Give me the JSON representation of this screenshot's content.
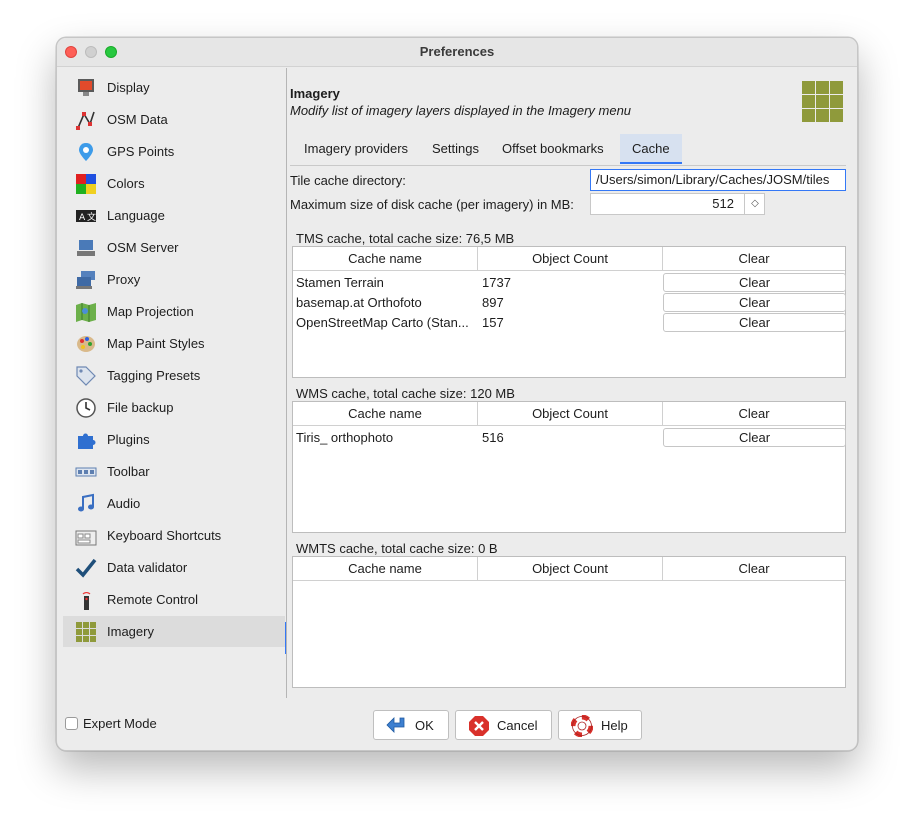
{
  "window": {
    "title": "Preferences"
  },
  "sidebar": {
    "items": [
      {
        "label": "Display",
        "icon": "display-icon"
      },
      {
        "label": "OSM Data",
        "icon": "osm-data-icon"
      },
      {
        "label": "GPS Points",
        "icon": "gps-points-icon"
      },
      {
        "label": "Colors",
        "icon": "colors-icon"
      },
      {
        "label": "Language",
        "icon": "language-icon"
      },
      {
        "label": "OSM Server",
        "icon": "osm-server-icon"
      },
      {
        "label": "Proxy",
        "icon": "proxy-icon"
      },
      {
        "label": "Map Projection",
        "icon": "map-projection-icon"
      },
      {
        "label": "Map Paint Styles",
        "icon": "map-paint-styles-icon"
      },
      {
        "label": "Tagging Presets",
        "icon": "tagging-presets-icon"
      },
      {
        "label": "File backup",
        "icon": "file-backup-icon"
      },
      {
        "label": "Plugins",
        "icon": "plugins-icon"
      },
      {
        "label": "Toolbar",
        "icon": "toolbar-icon"
      },
      {
        "label": "Audio",
        "icon": "audio-icon"
      },
      {
        "label": "Keyboard Shortcuts",
        "icon": "keyboard-shortcuts-icon"
      },
      {
        "label": "Data validator",
        "icon": "data-validator-icon"
      },
      {
        "label": "Remote Control",
        "icon": "remote-control-icon"
      },
      {
        "label": "Imagery",
        "icon": "imagery-icon",
        "selected": true
      }
    ]
  },
  "header": {
    "title": "Imagery",
    "subtitle": "Modify list of imagery layers displayed in the Imagery menu"
  },
  "tabs": [
    "Imagery providers",
    "Settings",
    "Offset bookmarks",
    "Cache"
  ],
  "active_tab": "Cache",
  "cache": {
    "dir_label": "Tile cache directory:",
    "dir_value": "/Users/simon/Library/Caches/JOSM/tiles",
    "max_label": "Maximum size of disk cache (per imagery) in MB:",
    "max_value": "512",
    "columns": [
      "Cache name",
      "Object Count",
      "Clear"
    ],
    "tms_label": "TMS cache, total cache size: 76,5 MB",
    "tms_rows": [
      {
        "name": "Stamen Terrain",
        "count": "1737",
        "clear": "Clear"
      },
      {
        "name": "basemap.at Orthofoto",
        "count": "897",
        "clear": "Clear"
      },
      {
        "name": "OpenStreetMap Carto (Stan...",
        "count": "157",
        "clear": "Clear"
      }
    ],
    "wms_label": "WMS cache, total cache size: 120 MB",
    "wms_rows": [
      {
        "name": "Tiris_ orthophoto",
        "count": "516",
        "clear": "Clear"
      }
    ],
    "wmts_label": "WMTS cache, total cache size: 0 B",
    "wmts_rows": []
  },
  "footer": {
    "expert_mode": "Expert Mode",
    "expert_checked": false,
    "ok": "OK",
    "cancel": "Cancel",
    "help": "Help"
  },
  "colors": {
    "accent": "#3478f6",
    "imagery_green": "#8f9a3b"
  }
}
